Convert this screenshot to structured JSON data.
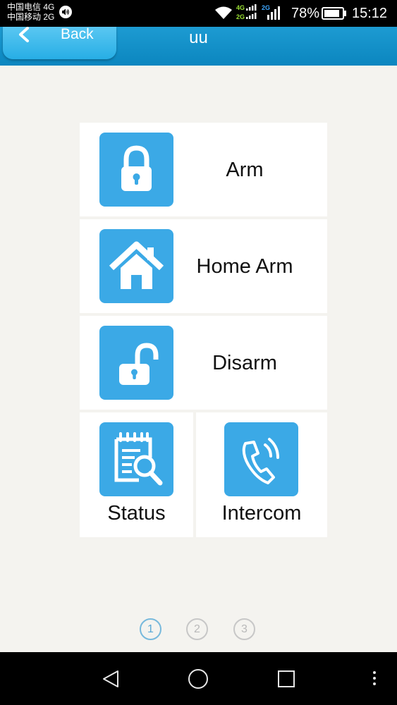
{
  "status_bar": {
    "carrier_1": "中国电信 4G",
    "carrier_2": "中国移动 2G",
    "net_top": "4G",
    "net_bottom": "2G",
    "net_right": "2G",
    "battery_percent": "78%",
    "time": "15:12"
  },
  "header": {
    "back_label": "Back",
    "title": "uu"
  },
  "controls": {
    "arm": "Arm",
    "home_arm": "Home Arm",
    "disarm": "Disarm",
    "status": "Status",
    "intercom": "Intercom"
  },
  "pager": {
    "pages": [
      "1",
      "2",
      "3"
    ],
    "current": "1"
  },
  "colors": {
    "header": "#1d9bd2",
    "icon_tile": "#3ba9e6",
    "background": "#f4f3ef"
  },
  "icons": {
    "arm": "lock-closed-icon",
    "home_arm": "house-icon",
    "disarm": "lock-open-icon",
    "status": "notepad-search-icon",
    "intercom": "phone-icon"
  }
}
